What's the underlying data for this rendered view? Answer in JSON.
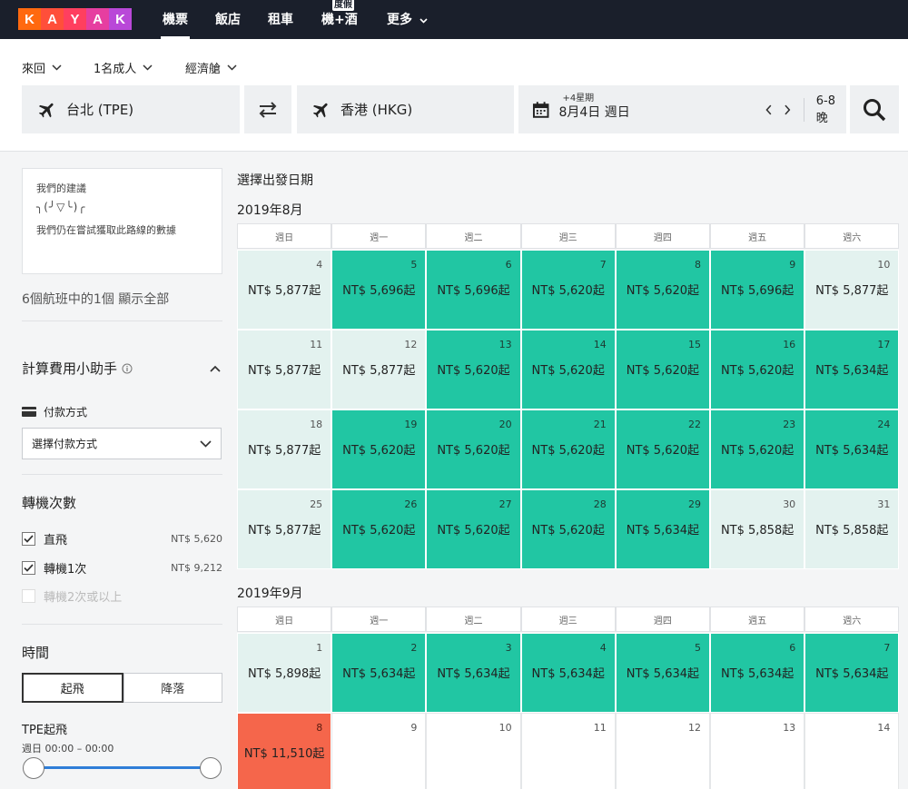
{
  "nav": {
    "logo_letters": [
      "K",
      "A",
      "Y",
      "A",
      "K"
    ],
    "logo_colors": [
      "#ff690f",
      "#ff4f3a",
      "#ff3f5f",
      "#e63ea0",
      "#b948d8"
    ],
    "items": [
      "機票",
      "飯店",
      "租車",
      "機+酒",
      "更多"
    ],
    "badge": "度假"
  },
  "search": {
    "trip_type": "來回",
    "travelers": "1名成人",
    "cabin": "經濟艙",
    "origin": "台北 (TPE)",
    "destination": "香港 (HKG)",
    "date_hint": "+4星期",
    "date": "8月4日 週日",
    "nights": "6-8晚"
  },
  "sidebar": {
    "rec_title": "我們的建議",
    "rec_face": "╮(╯▽╰)╭",
    "rec_msg": "我們仍在嘗試獲取此路線的數據",
    "count": "6個航班中的1個 顯示全部",
    "calc_title": "計算費用小助手",
    "payment_label": "付款方式",
    "payment_select": "選擇付款方式",
    "stops_title": "轉機次數",
    "stops": [
      {
        "label": "直飛",
        "price": "NT$ 5,620",
        "checked": true,
        "disabled": false
      },
      {
        "label": "轉機1次",
        "price": "NT$ 9,212",
        "checked": true,
        "disabled": false
      },
      {
        "label": "轉機2次或以上",
        "price": "",
        "checked": false,
        "disabled": true
      }
    ],
    "time_title": "時間",
    "tab_depart": "起飛",
    "tab_arrive": "降落",
    "dep_label": "TPE起飛",
    "dep_range": "週日 00:00 – 00:00"
  },
  "calendar": {
    "heading": "選擇出發日期",
    "weekdays": [
      "週日",
      "週一",
      "週二",
      "週三",
      "週四",
      "週五",
      "週六"
    ],
    "months": [
      {
        "title": "2019年8月",
        "rows": [
          [
            {
              "d": "4",
              "p": "NT$ 5,877起",
              "c": "l"
            },
            {
              "d": "5",
              "p": "NT$ 5,696起",
              "c": "g"
            },
            {
              "d": "6",
              "p": "NT$ 5,696起",
              "c": "g"
            },
            {
              "d": "7",
              "p": "NT$ 5,620起",
              "c": "g"
            },
            {
              "d": "8",
              "p": "NT$ 5,620起",
              "c": "g"
            },
            {
              "d": "9",
              "p": "NT$ 5,696起",
              "c": "g"
            },
            {
              "d": "10",
              "p": "NT$ 5,877起",
              "c": "l"
            }
          ],
          [
            {
              "d": "11",
              "p": "NT$ 5,877起",
              "c": "l"
            },
            {
              "d": "12",
              "p": "NT$ 5,877起",
              "c": "l"
            },
            {
              "d": "13",
              "p": "NT$ 5,620起",
              "c": "g"
            },
            {
              "d": "14",
              "p": "NT$ 5,620起",
              "c": "g"
            },
            {
              "d": "15",
              "p": "NT$ 5,620起",
              "c": "g"
            },
            {
              "d": "16",
              "p": "NT$ 5,620起",
              "c": "g"
            },
            {
              "d": "17",
              "p": "NT$ 5,634起",
              "c": "g"
            }
          ],
          [
            {
              "d": "18",
              "p": "NT$ 5,877起",
              "c": "l"
            },
            {
              "d": "19",
              "p": "NT$ 5,620起",
              "c": "g"
            },
            {
              "d": "20",
              "p": "NT$ 5,620起",
              "c": "g"
            },
            {
              "d": "21",
              "p": "NT$ 5,620起",
              "c": "g"
            },
            {
              "d": "22",
              "p": "NT$ 5,620起",
              "c": "g"
            },
            {
              "d": "23",
              "p": "NT$ 5,620起",
              "c": "g"
            },
            {
              "d": "24",
              "p": "NT$ 5,634起",
              "c": "g"
            }
          ],
          [
            {
              "d": "25",
              "p": "NT$ 5,877起",
              "c": "l"
            },
            {
              "d": "26",
              "p": "NT$ 5,620起",
              "c": "g"
            },
            {
              "d": "27",
              "p": "NT$ 5,620起",
              "c": "g"
            },
            {
              "d": "28",
              "p": "NT$ 5,620起",
              "c": "g"
            },
            {
              "d": "29",
              "p": "NT$ 5,634起",
              "c": "g"
            },
            {
              "d": "30",
              "p": "NT$ 5,858起",
              "c": "l"
            },
            {
              "d": "31",
              "p": "NT$ 5,858起",
              "c": "l"
            }
          ]
        ]
      },
      {
        "title": "2019年9月",
        "rows": [
          [
            {
              "d": "1",
              "p": "NT$ 5,898起",
              "c": "l"
            },
            {
              "d": "2",
              "p": "NT$ 5,634起",
              "c": "g"
            },
            {
              "d": "3",
              "p": "NT$ 5,634起",
              "c": "g"
            },
            {
              "d": "4",
              "p": "NT$ 5,634起",
              "c": "g"
            },
            {
              "d": "5",
              "p": "NT$ 5,634起",
              "c": "g"
            },
            {
              "d": "6",
              "p": "NT$ 5,634起",
              "c": "g"
            },
            {
              "d": "7",
              "p": "NT$ 5,634起",
              "c": "g"
            }
          ],
          [
            {
              "d": "8",
              "p": "NT$ 11,510起",
              "c": "r"
            },
            {
              "d": "9",
              "p": "",
              "c": "w"
            },
            {
              "d": "10",
              "p": "",
              "c": "w"
            },
            {
              "d": "11",
              "p": "",
              "c": "w"
            },
            {
              "d": "12",
              "p": "",
              "c": "w"
            },
            {
              "d": "13",
              "p": "",
              "c": "w"
            },
            {
              "d": "14",
              "p": "",
              "c": "w"
            }
          ]
        ]
      }
    ]
  }
}
